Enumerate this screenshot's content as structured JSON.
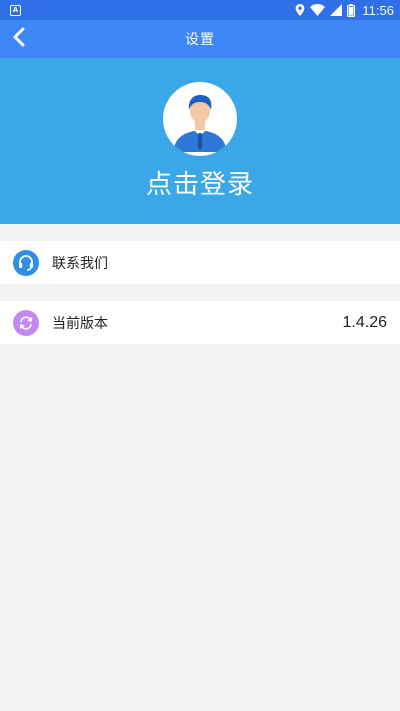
{
  "status_bar": {
    "notification_glyph": "A",
    "time": "11:56",
    "icons": [
      "location-icon",
      "wifi-icon",
      "signal-icon",
      "battery-icon"
    ]
  },
  "nav": {
    "title": "设置",
    "back_icon": "chevron-left-icon"
  },
  "header": {
    "avatar_icon": "user-avatar-icon",
    "login_label": "点击登录"
  },
  "menu": {
    "contact": {
      "label": "联系我们",
      "icon": "headset-icon",
      "icon_color": "#2f8fe8"
    },
    "version": {
      "label": "当前版本",
      "value": "1.4.26",
      "icon": "refresh-icon",
      "icon_color": "#c08af0"
    }
  },
  "colors": {
    "status_bar": "#2f6fe8",
    "nav_bar": "#3f86f6",
    "header": "#3aa8e8",
    "background": "#f2f2f2"
  }
}
